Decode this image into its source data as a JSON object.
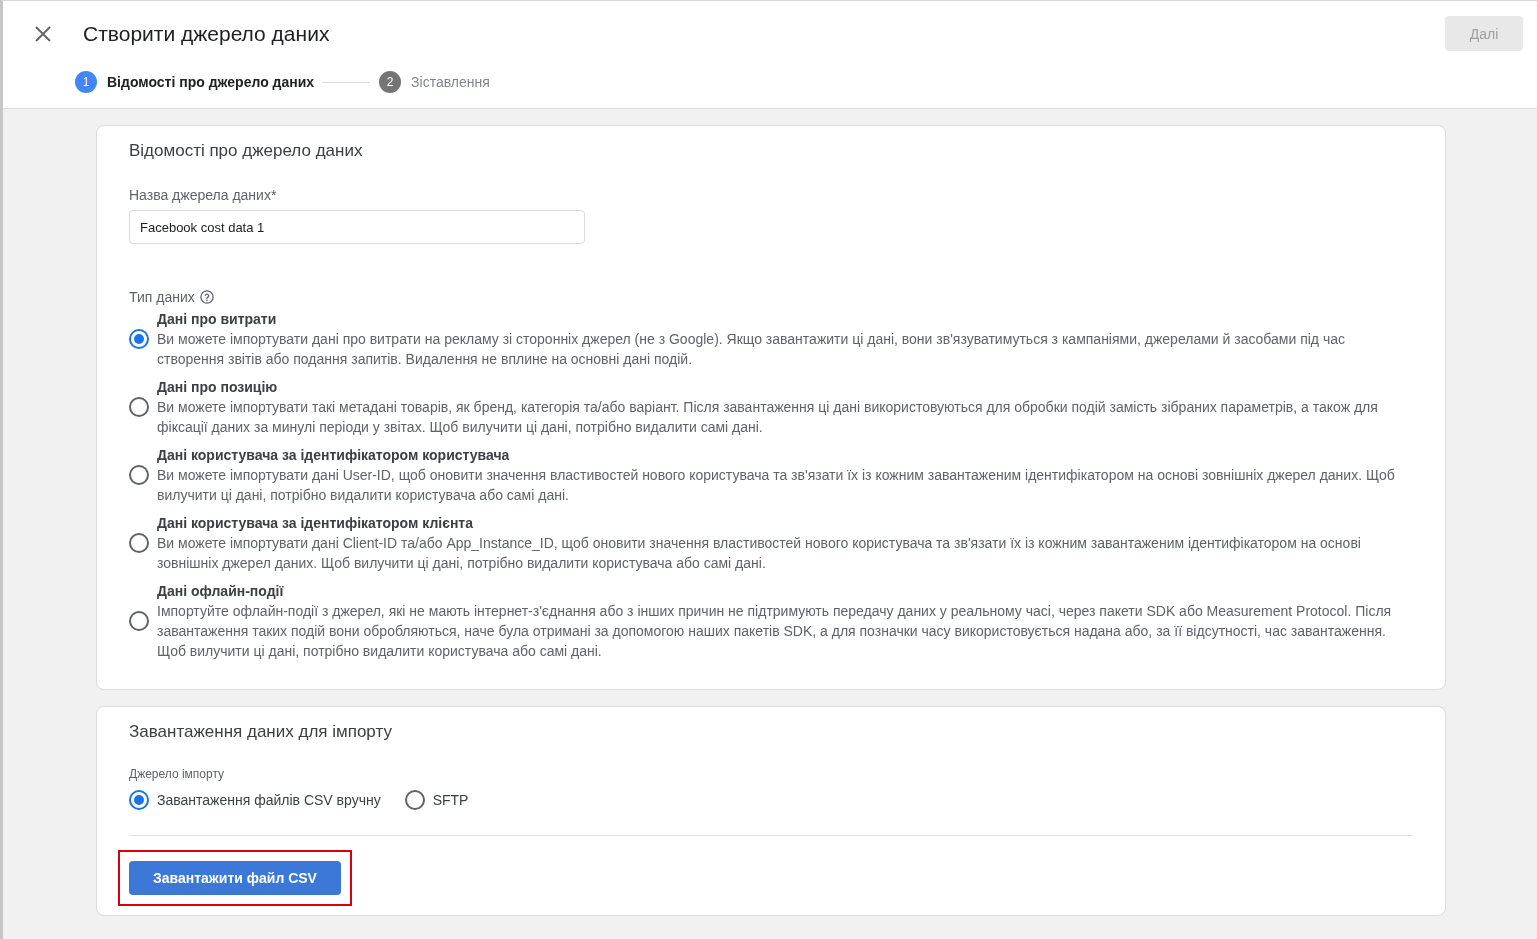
{
  "dialog": {
    "title": "Створити джерело даних",
    "next_button": {
      "label": "Далі",
      "disabled": true
    }
  },
  "stepper": [
    {
      "number": "1",
      "label": "Відомості про джерело даних",
      "selected": true
    },
    {
      "number": "2",
      "label": "Зіставлення",
      "selected": false
    }
  ],
  "details_card": {
    "title": "Відомості про джерело даних",
    "name_field": {
      "label": "Назва джерела даних*",
      "value": "Facebook cost data 1"
    },
    "data_type": {
      "label": "Тип даних",
      "options": [
        {
          "title": "Дані про витрати",
          "description": "Ви можете імпортувати дані про витрати на рекламу зі сторонніх джерел (не з Google). Якщо завантажити ці дані, вони зв'язуватимуться з кампаніями, джерелами й засобами під час створення звітів або подання запитів. Видалення не вплине на основні дані подій.",
          "selected": true
        },
        {
          "title": "Дані про позицію",
          "description": "Ви можете імпортувати такі метадані товарів, як бренд, категорія та/або варіант. Після завантаження ці дані використовуються для обробки подій замість зібраних параметрів, а також для фіксації даних за минулі періоди у звітах. Щоб вилучити ці дані, потрібно видалити самі дані.",
          "selected": false
        },
        {
          "title": "Дані користувача за ідентифікатором користувача",
          "description": "Ви можете імпортувати дані User-ID, щоб оновити значення властивостей нового користувача та зв'язати їх із кожним завантаженим ідентифікатором на основі зовнішніх джерел даних. Щоб вилучити ці дані, потрібно видалити користувача або самі дані.",
          "selected": false
        },
        {
          "title": "Дані користувача за ідентифікатором клієнта",
          "description": "Ви можете імпортувати дані Client-ID та/або App_Instance_ID, щоб оновити значення властивостей нового користувача та зв'язати їх із кожним завантаженим ідентифікатором на основі зовнішніх джерел даних. Щоб вилучити ці дані, потрібно видалити користувача або самі дані.",
          "selected": false
        },
        {
          "title": "Дані офлайн-події",
          "description": "Імпортуйте офлайн-події з джерел, які не мають інтернет-з'єднання або з інших причин не підтримують передачу даних у реальному часі, через пакети SDK або Measurement Protocol. Після завантаження таких подій вони обробляються, наче була отримані за допомогою наших пакетів SDK, а для позначки часу використовується надана або, за її відсутності, час завантаження. Щоб вилучити ці дані, потрібно видалити користувача або самі дані.",
          "selected": false
        }
      ]
    }
  },
  "upload_card": {
    "title": "Завантаження даних для імпорту",
    "import_source": {
      "label": "Джерело імпорту",
      "options": [
        {
          "label": "Завантаження файлів CSV вручну",
          "selected": true
        },
        {
          "label": "SFTP",
          "selected": false
        }
      ]
    },
    "upload_button": {
      "label": "Завантажити файл CSV",
      "highlighted": true
    }
  }
}
